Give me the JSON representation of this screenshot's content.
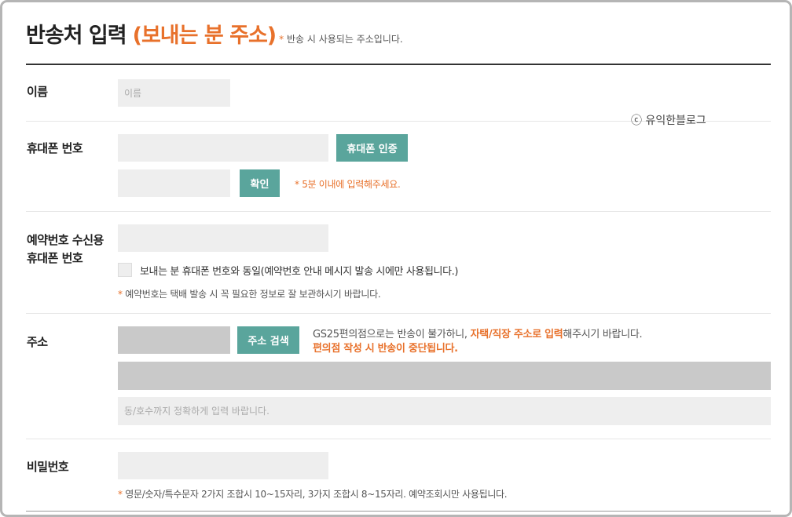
{
  "header": {
    "title": "반송처 입력",
    "title_accent": "(보내는 분 주소)",
    "note_star": "*",
    "note": "반송 시 사용되는 주소입니다."
  },
  "watermark": "ⓒ 유익한블로그",
  "name": {
    "label": "이름",
    "placeholder": "이름"
  },
  "phone": {
    "label": "휴대폰 번호",
    "verify_button": "휴대폰 인증",
    "confirm_button": "확인",
    "note": "* 5분 이내에 입력해주세요."
  },
  "reservation": {
    "label_line1": "예약번호 수신용",
    "label_line2": "휴대폰 번호",
    "same_checkbox_label": "보내는 분 휴대폰 번호와 동일(예약번호 안내 메시지 발송 시에만 사용됩니다.)",
    "note_star": "*",
    "note": "예약번호는 택배 발송 시 꼭 필요한 정보로 잘 보관하시기 바랍니다."
  },
  "address": {
    "label": "주소",
    "search_button": "주소 검색",
    "info_part1": "GS25편의점으로는 반송이 불가하니, ",
    "info_highlight": "자택/직장 주소로 입력",
    "info_part2": "해주시기 바랍니다.",
    "info_warning": "편의점 작성 시 반송이 중단됩니다.",
    "detail_placeholder": "동/호수까지 정확하게 입력 바랍니다."
  },
  "password": {
    "label": "비밀번호",
    "note_star": "*",
    "note": "영문/숫자/특수문자 2가지 조합시 10~15자리, 3가지 조합시 8~15자리. 예약조회시만 사용됩니다."
  },
  "colors": {
    "accent": "#e8712b",
    "button": "#5aa59c",
    "input_bg": "#eeeeee"
  }
}
